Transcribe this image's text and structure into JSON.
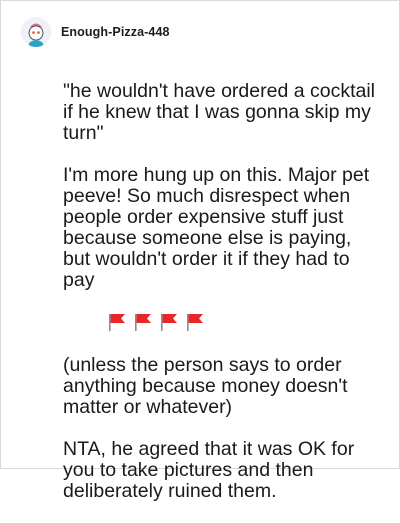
{
  "comment": {
    "username": "Enough-Pizza-448",
    "avatar_icon": "snoo-avatar-icon",
    "paragraphs": [
      "\"he wouldn't have ordered a cocktail if he knew that I was gonna skip my turn\"",
      "I'm more hung up on this. Major pet peeve! So much disrespect when people order expensive stuff just because someone else is paying, but wouldn't order it if they had to pay",
      "(unless the person says to order anything because money doesn't matter or whatever)",
      "NTA, he agreed that it was OK for you to take pictures and then deliberately ruined them."
    ],
    "flag_emoji_count": 4,
    "flag_color": "#e8262a"
  }
}
